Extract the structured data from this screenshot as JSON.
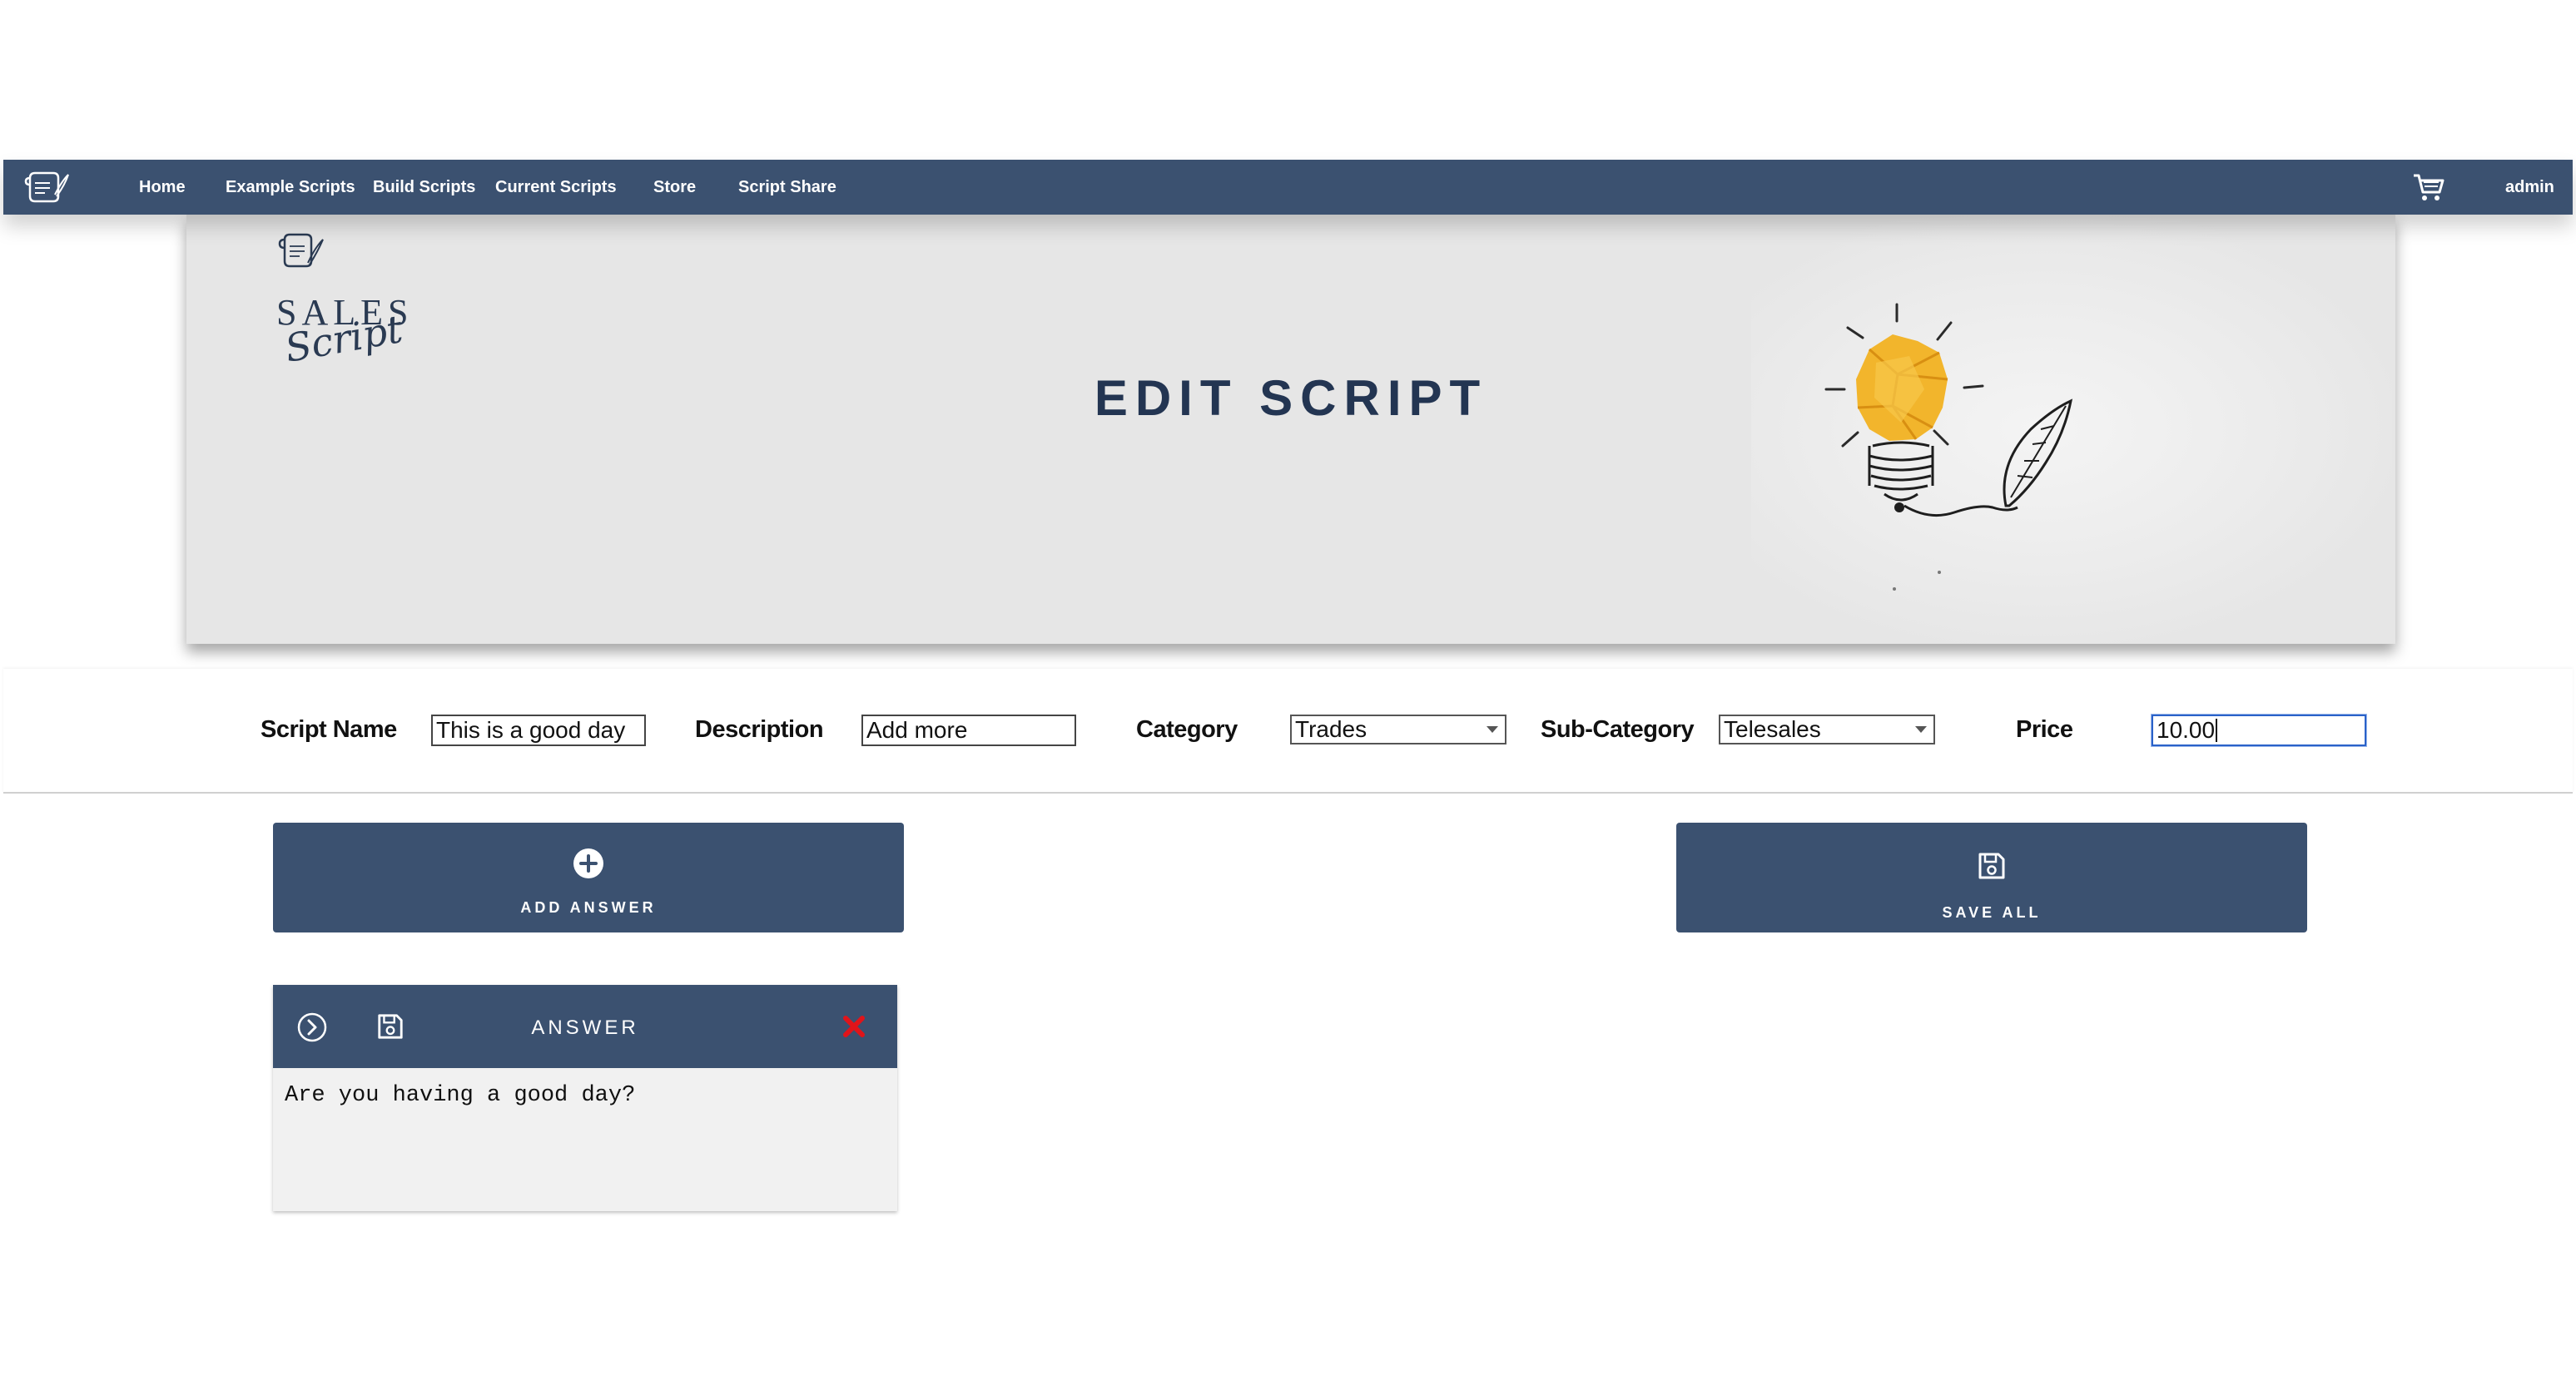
{
  "nav": {
    "links": [
      {
        "label": "Home"
      },
      {
        "label": "Example Scripts"
      },
      {
        "label": "Build Scripts"
      },
      {
        "label": "Current Scripts"
      },
      {
        "label": "Store"
      },
      {
        "label": "Script Share"
      }
    ],
    "cart_icon": "shopping-cart-icon",
    "user_label": "admin"
  },
  "hero": {
    "brand_line1": "SALES",
    "brand_line2": "Script",
    "title": "EDIT SCRIPT"
  },
  "form": {
    "script_name_label": "Script Name",
    "script_name_value": "This is a good day",
    "description_label": "Description",
    "description_value": "Add more",
    "category_label": "Category",
    "category_value": "Trades",
    "subcategory_label": "Sub-Category",
    "subcategory_value": "Telesales",
    "price_label": "Price",
    "price_value": "10.00"
  },
  "actions": {
    "add_answer_label": "ADD ANSWER",
    "add_answer_icon": "plus-circle-icon",
    "save_all_label": "SAVE ALL",
    "save_all_icon": "floppy-disk-icon"
  },
  "answers": [
    {
      "title": "ANSWER",
      "text": "Are you having a good day?",
      "expand_icon": "chevron-right-circle-icon",
      "save_icon": "floppy-disk-icon",
      "delete_icon": "close-icon"
    }
  ],
  "colors": {
    "primary": "#3b5170",
    "hero_bg": "#e6e6e6",
    "title": "#233552",
    "delete": "#e0141a"
  }
}
